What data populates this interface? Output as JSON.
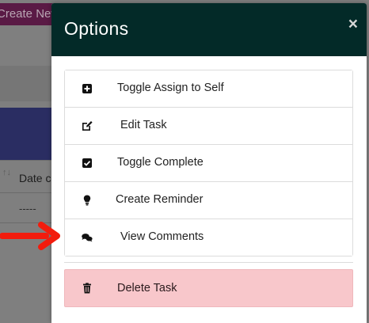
{
  "background": {
    "create_button": "Create New",
    "column_header": "Date co",
    "cell_value": "-----",
    "sort_glyph": "↑↓"
  },
  "modal": {
    "title": "Options",
    "close_glyph": "×",
    "items": [
      {
        "label": "Toggle Assign to Self",
        "icon": "plus-square-icon"
      },
      {
        "label": "Edit Task",
        "icon": "edit-icon"
      },
      {
        "label": "Toggle Complete",
        "icon": "check-square-icon"
      },
      {
        "label": "Create Reminder",
        "icon": "lightbulb-icon"
      },
      {
        "label": "View Comments",
        "icon": "comments-icon"
      }
    ],
    "delete": {
      "label": "Delete Task",
      "icon": "trash-icon"
    }
  },
  "colors": {
    "header_bg": "#032a28",
    "delete_bg": "#f8c7cb",
    "arrow": "#f21c0d"
  }
}
